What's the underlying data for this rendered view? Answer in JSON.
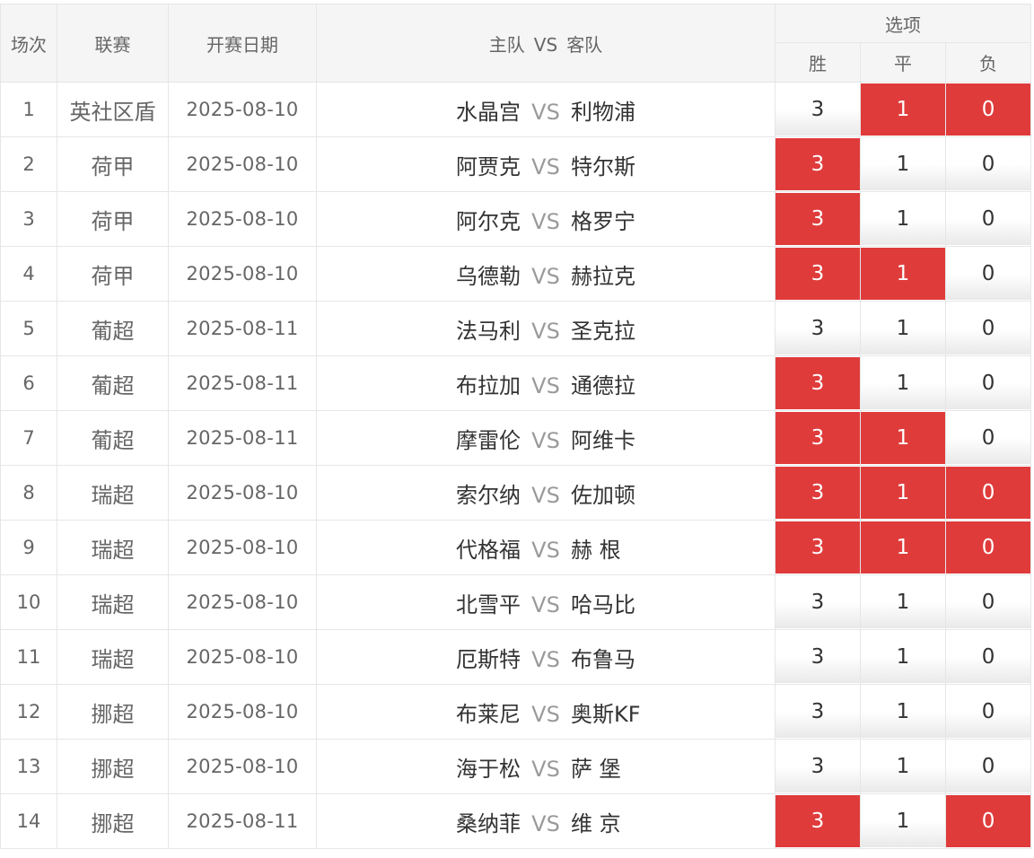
{
  "header": {
    "col_no": "场次",
    "col_league": "联赛",
    "col_date": "开赛日期",
    "col_home": "主队",
    "col_vs": "VS",
    "col_away": "客队",
    "col_options": "选项",
    "opt_win": "胜",
    "opt_draw": "平",
    "opt_loss": "负"
  },
  "colors": {
    "selected": "#e03b3b",
    "border": "#e6e6e6",
    "header_bg": "#f5f5f5"
  },
  "rows": [
    {
      "no": "1",
      "league": "英社区盾",
      "date": "2025-08-10",
      "home": "水晶宫",
      "vs": "VS",
      "away": "利物浦",
      "win": "3",
      "draw": "1",
      "loss": "0",
      "win_sel": false,
      "draw_sel": true,
      "loss_sel": true
    },
    {
      "no": "2",
      "league": "荷甲",
      "date": "2025-08-10",
      "home": "阿贾克",
      "vs": "VS",
      "away": "特尔斯",
      "win": "3",
      "draw": "1",
      "loss": "0",
      "win_sel": true,
      "draw_sel": false,
      "loss_sel": false
    },
    {
      "no": "3",
      "league": "荷甲",
      "date": "2025-08-10",
      "home": "阿尔克",
      "vs": "VS",
      "away": "格罗宁",
      "win": "3",
      "draw": "1",
      "loss": "0",
      "win_sel": true,
      "draw_sel": false,
      "loss_sel": false
    },
    {
      "no": "4",
      "league": "荷甲",
      "date": "2025-08-10",
      "home": "乌德勒",
      "vs": "VS",
      "away": "赫拉克",
      "win": "3",
      "draw": "1",
      "loss": "0",
      "win_sel": true,
      "draw_sel": true,
      "loss_sel": false
    },
    {
      "no": "5",
      "league": "葡超",
      "date": "2025-08-11",
      "home": "法马利",
      "vs": "VS",
      "away": "圣克拉",
      "win": "3",
      "draw": "1",
      "loss": "0",
      "win_sel": false,
      "draw_sel": false,
      "loss_sel": false
    },
    {
      "no": "6",
      "league": "葡超",
      "date": "2025-08-11",
      "home": "布拉加",
      "vs": "VS",
      "away": "通德拉",
      "win": "3",
      "draw": "1",
      "loss": "0",
      "win_sel": true,
      "draw_sel": false,
      "loss_sel": false
    },
    {
      "no": "7",
      "league": "葡超",
      "date": "2025-08-11",
      "home": "摩雷伦",
      "vs": "VS",
      "away": "阿维卡",
      "win": "3",
      "draw": "1",
      "loss": "0",
      "win_sel": true,
      "draw_sel": true,
      "loss_sel": false
    },
    {
      "no": "8",
      "league": "瑞超",
      "date": "2025-08-10",
      "home": "索尔纳",
      "vs": "VS",
      "away": "佐加顿",
      "win": "3",
      "draw": "1",
      "loss": "0",
      "win_sel": true,
      "draw_sel": true,
      "loss_sel": true
    },
    {
      "no": "9",
      "league": "瑞超",
      "date": "2025-08-10",
      "home": "代格福",
      "vs": "VS",
      "away": "赫 根",
      "win": "3",
      "draw": "1",
      "loss": "0",
      "win_sel": true,
      "draw_sel": true,
      "loss_sel": true
    },
    {
      "no": "10",
      "league": "瑞超",
      "date": "2025-08-10",
      "home": "北雪平",
      "vs": "VS",
      "away": "哈马比",
      "win": "3",
      "draw": "1",
      "loss": "0",
      "win_sel": false,
      "draw_sel": false,
      "loss_sel": false
    },
    {
      "no": "11",
      "league": "瑞超",
      "date": "2025-08-10",
      "home": "厄斯特",
      "vs": "VS",
      "away": "布鲁马",
      "win": "3",
      "draw": "1",
      "loss": "0",
      "win_sel": false,
      "draw_sel": false,
      "loss_sel": false
    },
    {
      "no": "12",
      "league": "挪超",
      "date": "2025-08-10",
      "home": "布莱尼",
      "vs": "VS",
      "away": "奥斯KF",
      "win": "3",
      "draw": "1",
      "loss": "0",
      "win_sel": false,
      "draw_sel": false,
      "loss_sel": false
    },
    {
      "no": "13",
      "league": "挪超",
      "date": "2025-08-10",
      "home": "海于松",
      "vs": "VS",
      "away": "萨 堡",
      "win": "3",
      "draw": "1",
      "loss": "0",
      "win_sel": false,
      "draw_sel": false,
      "loss_sel": false
    },
    {
      "no": "14",
      "league": "挪超",
      "date": "2025-08-11",
      "home": "桑纳菲",
      "vs": "VS",
      "away": "维 京",
      "win": "3",
      "draw": "1",
      "loss": "0",
      "win_sel": true,
      "draw_sel": false,
      "loss_sel": true
    }
  ]
}
